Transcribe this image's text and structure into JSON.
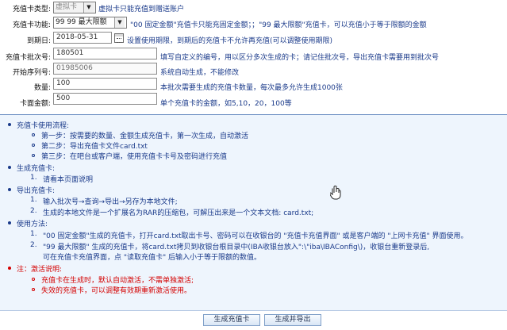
{
  "form": {
    "card_type": {
      "label": "充值卡类型:",
      "value": "虚拟卡",
      "hint": "虚拟卡只能充值到赠送账户"
    },
    "card_function": {
      "label": "充值卡功能:",
      "value": "99 99 最大限额",
      "hint": "\"00 固定金额\"充值卡只能充固定金额；；\"99 最大限额\"充值卡，可以充值小于等于限额的金额"
    },
    "expire_date": {
      "label": "到期日:",
      "value": "2018-05-31",
      "hint": "设置使用期限，到期后的充值卡不允许再充值(可以调整使用期限)"
    },
    "batch_no": {
      "label": "充值卡批次号:",
      "value": "180501",
      "hint": "填写自定义的编号，用以区分多次生成的卡；请记住批次号，导出充值卡需要用到批次号"
    },
    "start_serial": {
      "label": "开始序列号:",
      "value": "01985006",
      "hint": "系统自动生成，不能修改"
    },
    "quantity": {
      "label": "数量:",
      "value": "100",
      "hint": "本批次需要生成的充值卡数量，每次最多允许生成1000张"
    },
    "face_value": {
      "label": "卡面金额:",
      "value": "500",
      "hint": "单个充值卡的金额，如5,10，20，100等"
    }
  },
  "instructions": {
    "usage_flow": {
      "title": "充值卡使用流程:",
      "steps": [
        "第一步：按需要的数量、金额生成充值卡，第一次生成，自动激活",
        "第二步：导出充值卡文件card.txt",
        "第三步：在吧台或客户端，使用充值卡卡号及密码进行充值"
      ]
    },
    "generate": {
      "title": "生成充值卡:",
      "items": [
        "请看本页面说明"
      ]
    },
    "export": {
      "title": "导出充值卡:",
      "items": [
        "输入批次号→查询→导出→另存为本地文件;",
        "生成的本地文件是一个扩展名为RAR的压缩包，可解压出来是一个文本文档: card.txt;"
      ]
    },
    "method": {
      "title": "使用方法:",
      "items": [
        "\"00 固定金额\"生成的充值卡，打开card.txt取出卡号、密码可以在收银台的 \"充值卡充值界面\" 或是客户端的 \"上网卡充值\" 界面使用。",
        "\"99 最大限额\" 生成的充值卡，将card.txt拷贝到收银台根目录中(IBA收银台放入\":\\\"iba\\IBAConfig\\)，收银台重新登录后,",
        "可在充值卡充值界面，点 \"读取充值卡\" 后输入小于等于限额的数值。"
      ]
    },
    "note": {
      "title": "注：激活说明:",
      "items": [
        "充值卡在生成时，默认自动激活，不需单独激活;",
        "失效的充值卡，可以调整有效期重新激活使用。"
      ]
    }
  },
  "footer": {
    "generate_button": "生成充值卡",
    "generate_export_button": "生成并导出"
  },
  "numbers": {
    "n1": "1.",
    "n2": "2."
  },
  "colors": {
    "accent": "#1a3a8a",
    "note": "#d40000",
    "panel": "#eef5fd"
  }
}
